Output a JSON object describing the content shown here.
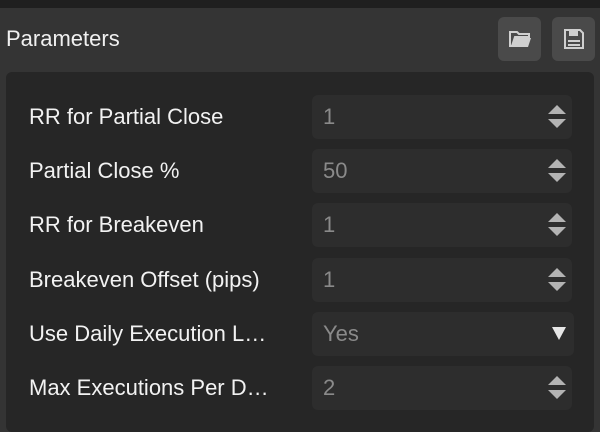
{
  "header": {
    "title": "Parameters",
    "open_icon": "folder-open-icon",
    "save_icon": "floppy-save-icon"
  },
  "params": [
    {
      "label": "RR for Partial Close",
      "value": "1",
      "control": "number"
    },
    {
      "label": "Partial Close %",
      "value": "50",
      "control": "number"
    },
    {
      "label": "RR for Breakeven",
      "value": "1",
      "control": "number"
    },
    {
      "label": "Breakeven Offset (pips)",
      "value": "1",
      "control": "number"
    },
    {
      "label": "Use Daily Execution L…",
      "value": "Yes",
      "control": "select"
    },
    {
      "label": "Max Executions Per D…",
      "value": "2",
      "control": "number"
    }
  ]
}
